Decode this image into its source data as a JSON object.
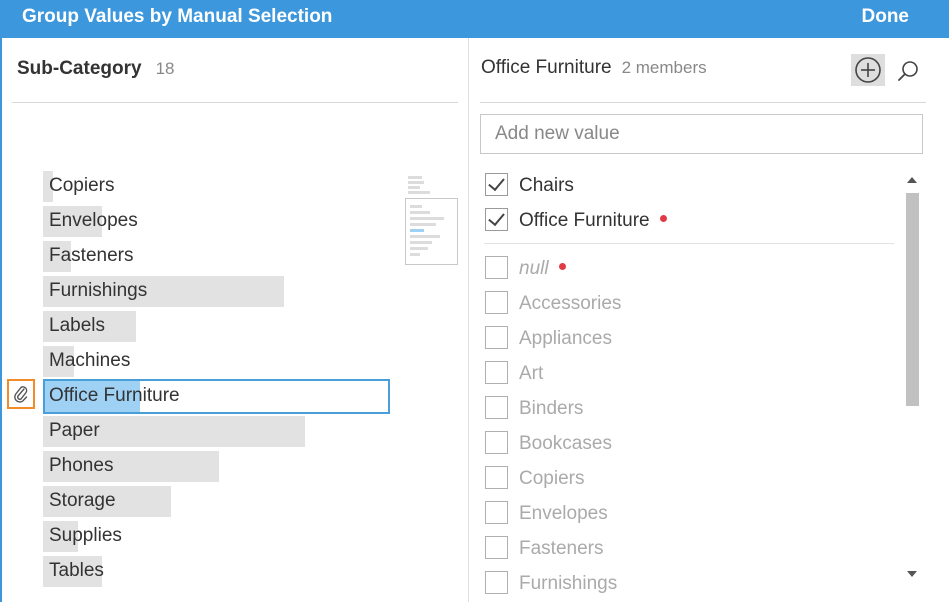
{
  "dialog": {
    "title": "Group Values by Manual Selection",
    "done_label": "Done"
  },
  "left": {
    "field_name": "Sub-Category",
    "count": "18",
    "values": [
      {
        "label": "Copiers",
        "bar": 0.03
      },
      {
        "label": "Envelopes",
        "bar": 0.17
      },
      {
        "label": "Fasteners",
        "bar": 0.08
      },
      {
        "label": "Furnishings",
        "bar": 0.7
      },
      {
        "label": "Labels",
        "bar": 0.27
      },
      {
        "label": "Machines",
        "bar": 0.09
      },
      {
        "label": "Office Furniture",
        "bar": 0.28,
        "selected": true
      },
      {
        "label": "Paper",
        "bar": 0.76
      },
      {
        "label": "Phones",
        "bar": 0.51
      },
      {
        "label": "Storage",
        "bar": 0.37
      },
      {
        "label": "Supplies",
        "bar": 0.1
      },
      {
        "label": "Tables",
        "bar": 0.17
      }
    ]
  },
  "right": {
    "group_name": "Office Furniture",
    "members_count": "2 members",
    "add_placeholder": "Add new value",
    "members": [
      {
        "label": "Chairs",
        "checked": true,
        "dot": false
      },
      {
        "label": "Office Furniture",
        "checked": true,
        "dot": true
      }
    ],
    "others": [
      {
        "label": "null",
        "checked": false,
        "dot": true,
        "italic": true
      },
      {
        "label": "Accessories",
        "checked": false
      },
      {
        "label": "Appliances",
        "checked": false
      },
      {
        "label": "Art",
        "checked": false
      },
      {
        "label": "Binders",
        "checked": false
      },
      {
        "label": "Bookcases",
        "checked": false
      },
      {
        "label": "Copiers",
        "checked": false
      },
      {
        "label": "Envelopes",
        "checked": false
      },
      {
        "label": "Fasteners",
        "checked": false
      },
      {
        "label": "Furnishings",
        "checked": false
      }
    ]
  },
  "icons": {
    "add": "plus-circle-icon",
    "search": "search-icon",
    "attach": "paperclip-icon"
  },
  "colors": {
    "header": "#3c97dc",
    "selection": "#4a9fd9",
    "highlight": "#f28c28",
    "dot": "#e03a45"
  }
}
